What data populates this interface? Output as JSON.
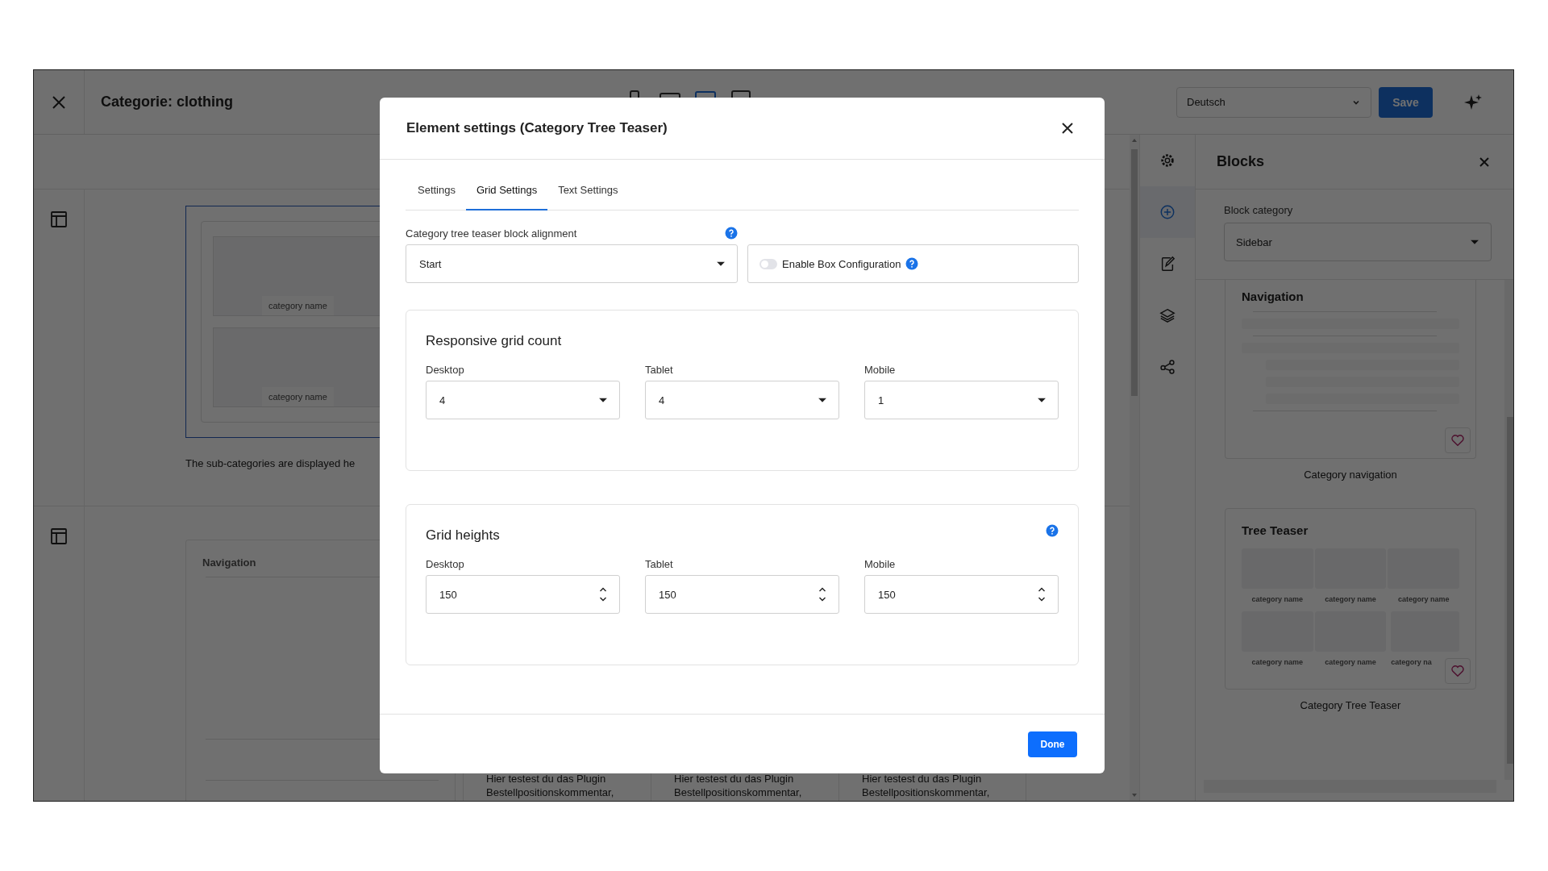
{
  "toolbar": {
    "title": "Categorie: clothing",
    "device_views": [
      {
        "kind": "mobile",
        "selected": false
      },
      {
        "kind": "tablet",
        "selected": false
      },
      {
        "kind": "laptop",
        "selected": true
      },
      {
        "kind": "desktop",
        "selected": false
      }
    ],
    "language": "Deutsch",
    "save": "Save"
  },
  "canvas": {
    "teaser_preview": {
      "category_names": [
        "category name",
        "category name"
      ],
      "caption": "The sub-categories are displayed he"
    },
    "navigation_preview": {
      "title": "Navigation"
    },
    "text_columns": [
      {
        "lines": [
          "Hier testest du das Plugin",
          "Bestellpositionskommentar,"
        ]
      },
      {
        "lines": [
          "Hier testest du das Plugin",
          "Bestellpositionskommentar,"
        ]
      },
      {
        "lines": [
          "Hier testest du das Plugin",
          "Bestellpositionskommentar,"
        ]
      }
    ]
  },
  "tool_rail": [
    {
      "kind": "settings",
      "selected": false
    },
    {
      "kind": "add",
      "selected": true
    },
    {
      "kind": "edit",
      "selected": false
    },
    {
      "kind": "layers",
      "selected": false
    },
    {
      "kind": "share",
      "selected": false
    }
  ],
  "blocks_panel": {
    "title": "Blocks",
    "category_label": "Block category",
    "category": "Sidebar",
    "blocks": [
      {
        "kind": "navigation",
        "title": "Navigation",
        "caption": "Category navigation"
      },
      {
        "kind": "tree_teaser",
        "title": "Tree Teaser",
        "category_names": [
          "category name",
          "category name",
          "category name",
          "category name",
          "category name",
          "category na"
        ],
        "caption": "Category Tree Teaser"
      }
    ]
  },
  "modal": {
    "title": "Element settings (Category Tree Teaser)",
    "tabs": [
      {
        "label": "Settings",
        "selected": false
      },
      {
        "label": "Grid Settings",
        "selected": true
      },
      {
        "label": "Text Settings",
        "selected": false
      }
    ],
    "alignment": {
      "label": "Category tree teaser block alignment",
      "help": true,
      "value": "Start"
    },
    "box_config": {
      "label": "Enable Box Configuration",
      "on": false,
      "help": true
    },
    "sections": [
      {
        "kind": "select",
        "title": "Responsive grid count",
        "help": false,
        "fields": [
          {
            "label": "Desktop",
            "value": "4"
          },
          {
            "label": "Tablet",
            "value": "4"
          },
          {
            "label": "Mobile",
            "value": "1"
          }
        ]
      },
      {
        "kind": "number",
        "title": "Grid heights",
        "help": true,
        "fields": [
          {
            "label": "Desktop",
            "value": "150"
          },
          {
            "label": "Tablet",
            "value": "150"
          },
          {
            "label": "Mobile",
            "value": "150"
          }
        ]
      }
    ],
    "done": "Done"
  }
}
